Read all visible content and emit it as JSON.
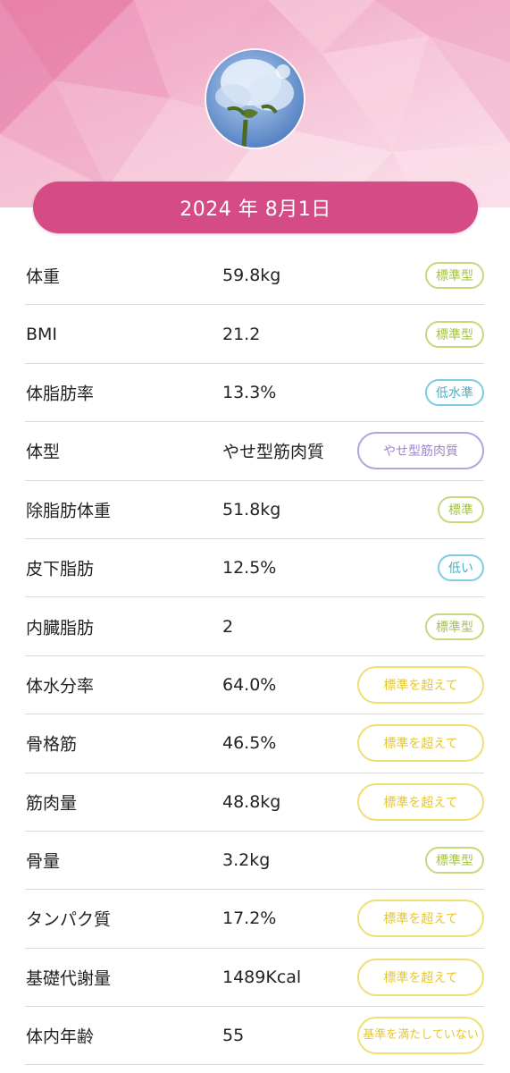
{
  "header": {
    "avatar_icon": "flower-photo-avatar",
    "date": "2024 年 8月1日",
    "accent_color": "#d54b86"
  },
  "metrics": [
    {
      "label": "体重",
      "value": "59.8kg",
      "badge": "標準型",
      "status": "green"
    },
    {
      "label": "BMI",
      "value": "21.2",
      "badge": "標準型",
      "status": "green"
    },
    {
      "label": "体脂肪率",
      "value": "13.3%",
      "badge": "低水準",
      "status": "blue"
    },
    {
      "label": "体型",
      "value": "やせ型筋肉質",
      "badge": "やせ型筋肉質",
      "status": "purple"
    },
    {
      "label": "除脂肪体重",
      "value": "51.8kg",
      "badge": "標準",
      "status": "green"
    },
    {
      "label": "皮下脂肪",
      "value": "12.5%",
      "badge": "低い",
      "status": "blue"
    },
    {
      "label": "内臓脂肪",
      "value": "2",
      "badge": "標準型",
      "status": "green"
    },
    {
      "label": "体水分率",
      "value": "64.0%",
      "badge": "標準を超えて",
      "status": "yellow"
    },
    {
      "label": "骨格筋",
      "value": "46.5%",
      "badge": "標準を超えて",
      "status": "yellow"
    },
    {
      "label": "筋肉量",
      "value": "48.8kg",
      "badge": "標準を超えて",
      "status": "yellow"
    },
    {
      "label": "骨量",
      "value": "3.2kg",
      "badge": "標準型",
      "status": "green"
    },
    {
      "label": "タンパク質",
      "value": "17.2%",
      "badge": "標準を超えて",
      "status": "yellow"
    },
    {
      "label": "基礎代謝量",
      "value": "1489Kcal",
      "badge": "標準を超えて",
      "status": "yellow"
    },
    {
      "label": "体内年齢",
      "value": "55",
      "badge": "基準を満たしていない",
      "status": "yellow"
    }
  ],
  "status_colors": {
    "green": "#a5c24a",
    "blue": "#4aafcc",
    "purple": "#9c86cc",
    "yellow": "#e6c82a"
  }
}
